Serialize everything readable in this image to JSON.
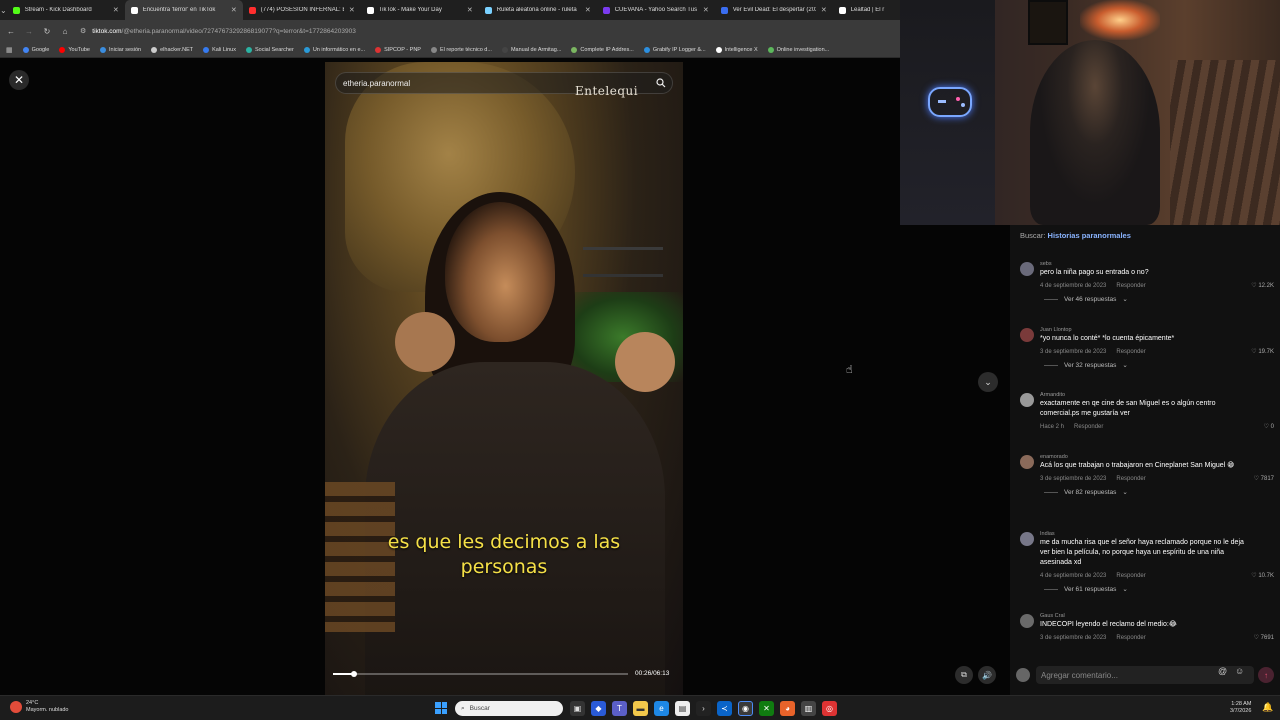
{
  "browser": {
    "tabs": [
      {
        "label": "Stream - Kick Dashboard",
        "color": "#53fc18",
        "active": false
      },
      {
        "label": "Encuentra 'terror' en TikTok",
        "color": "#ffffff",
        "active": true
      },
      {
        "label": "(774) POSESION INFERNAL: EV",
        "color": "#ff2e2e",
        "active": false
      },
      {
        "label": "TikTok - Make Your Day",
        "color": "#ffffff",
        "active": false
      },
      {
        "label": "Ruleta aleatoria online - ruleta",
        "color": "#7ad1ff",
        "active": false
      },
      {
        "label": "CUEVANA - Yahoo Search Tus r",
        "color": "#7b3bf0",
        "active": false
      },
      {
        "label": "Ver Evil Dead: El despertar (202",
        "color": "#3a6df0",
        "active": false
      },
      {
        "label": "Lealtad | El r",
        "color": "#ffffff",
        "active": false
      }
    ],
    "url_host": "tiktok.com",
    "url_path": "/@etheria.paranormal/video/7274767329286819077?q=terror&t=1772864203903",
    "bookmarks": [
      {
        "label": "Google",
        "color": "#4285f4"
      },
      {
        "label": "YouTube",
        "color": "#ff0000"
      },
      {
        "label": "Iniciar sesión",
        "color": "#3a8ddf"
      },
      {
        "label": "elhacker.NET",
        "color": "#cccccc"
      },
      {
        "label": "Kali Linux",
        "color": "#367bf0"
      },
      {
        "label": "Social Searcher",
        "color": "#2bb3a3"
      },
      {
        "label": "Un informático en e...",
        "color": "#2a9ad8"
      },
      {
        "label": "SIPCOP - PNP",
        "color": "#d33"
      },
      {
        "label": "El reporte técnico d...",
        "color": "#888888"
      },
      {
        "label": "Manual de Armitag...",
        "color": "#444444"
      },
      {
        "label": "Complete IP Addres...",
        "color": "#7bb661"
      },
      {
        "label": "Grabify IP Logger &...",
        "color": "#2c8fe0"
      },
      {
        "label": "Intelligence X",
        "color": "#ffffff"
      },
      {
        "label": "Online investigation...",
        "color": "#5cb85c"
      }
    ]
  },
  "video": {
    "search_query": "etheria.paranormal",
    "watermark": "Entelequi",
    "subtitle_line1": "es que les decimos a las",
    "subtitle_line2": "personas",
    "progress": 0.071,
    "timecode": "00:26/06:13"
  },
  "comments_panel": {
    "search_prefix": "Buscar:",
    "search_term": "Historias paranormales",
    "items": [
      {
        "user": "sebs",
        "text": "pero la niña pago su entrada o no?",
        "date": "4 de septiembre de 2023",
        "reply": "Responder",
        "likes": "12.2K",
        "replies": "Ver 46 respuestas",
        "avatar_color": "#6a6a7a"
      },
      {
        "user": "Juan Llontop",
        "text": "*yo nunca lo conté* *lo cuenta épicamente*",
        "date": "3 de septiembre de 2023",
        "reply": "Responder",
        "likes": "19.7K",
        "replies": "Ver 32 respuestas",
        "avatar_color": "#7a3a3a"
      },
      {
        "user": "Armandito",
        "text": "exactamente en qe cine de san Miguel es o algún centro comercial.ps me gustaría ver",
        "date": "Hace 2 h",
        "reply": "Responder",
        "likes": "0",
        "replies": "",
        "avatar_color": "#999999"
      },
      {
        "user": "enamorado",
        "text": "Acá los que trabajan o trabajaron en Cineplanet San Miguel 😁",
        "date": "3 de septiembre de 2023",
        "reply": "Responder",
        "likes": "7817",
        "replies": "Ver 82 respuestas",
        "avatar_color": "#8a6a5a"
      },
      {
        "user": "Indias",
        "text": "me da mucha risa que el señor haya reclamado porque no le deja ver bien la película, no porque haya un espíritu de una niña asesinada xd",
        "date": "4 de septiembre de 2023",
        "reply": "Responder",
        "likes": "10.7K",
        "replies": "Ver 61 respuestas",
        "avatar_color": "#777788"
      },
      {
        "user": "Gaus Cral",
        "text": "INDECOPI leyendo el reclamo del medio:😂",
        "date": "3 de septiembre de 2023",
        "reply": "Responder",
        "likes": "7691",
        "replies": "",
        "avatar_color": "#6a6a6a"
      }
    ],
    "input_placeholder": "Agregar comentario..."
  },
  "taskbar": {
    "weather_temp": "24°C",
    "weather_desc": "Mayorm. nublado",
    "search_label": "Buscar",
    "time": "1:28 AM",
    "date": "3/7/2026"
  }
}
